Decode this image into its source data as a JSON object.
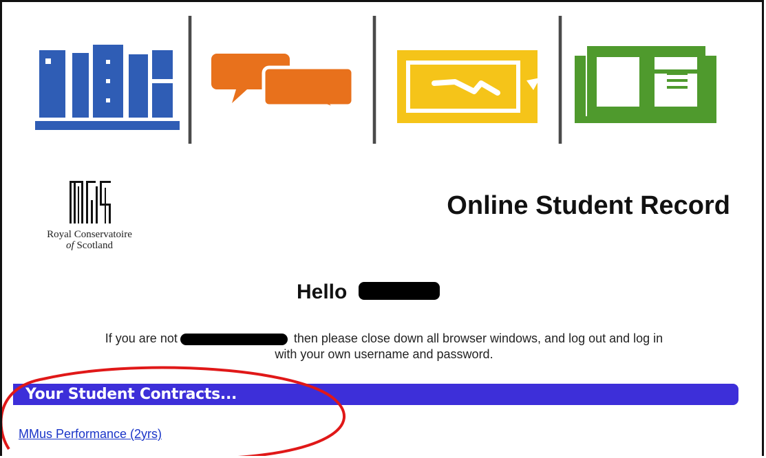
{
  "header": {
    "icons": [
      {
        "name": "bookshelf-icon",
        "color": "#2f5db5"
      },
      {
        "name": "chat-bubbles-icon",
        "color": "#e8711c"
      },
      {
        "name": "tablet-signal-icon",
        "color": "#f5c419"
      },
      {
        "name": "open-book-icon",
        "color": "#4f9a2d"
      }
    ],
    "divider_color": "#4a4a4a"
  },
  "logo": {
    "line1": "Royal Conservatoire",
    "line2_prefix": "of",
    "line2_suffix": " Scotland"
  },
  "page_title": "Online Student Record",
  "greeting": {
    "prefix": "Hello "
  },
  "notice": {
    "part1": "If you are not",
    "part2": " then please close down all browser windows, and log out and log in",
    "part3": "with your own username and password."
  },
  "contracts": {
    "heading": "Your Student Contracts...",
    "items": [
      {
        "label": "MMus Performance (2yrs)"
      }
    ]
  },
  "colors": {
    "section_bar": "#3d2fd9",
    "link": "#1a35c8",
    "annotation": "#e01818"
  }
}
